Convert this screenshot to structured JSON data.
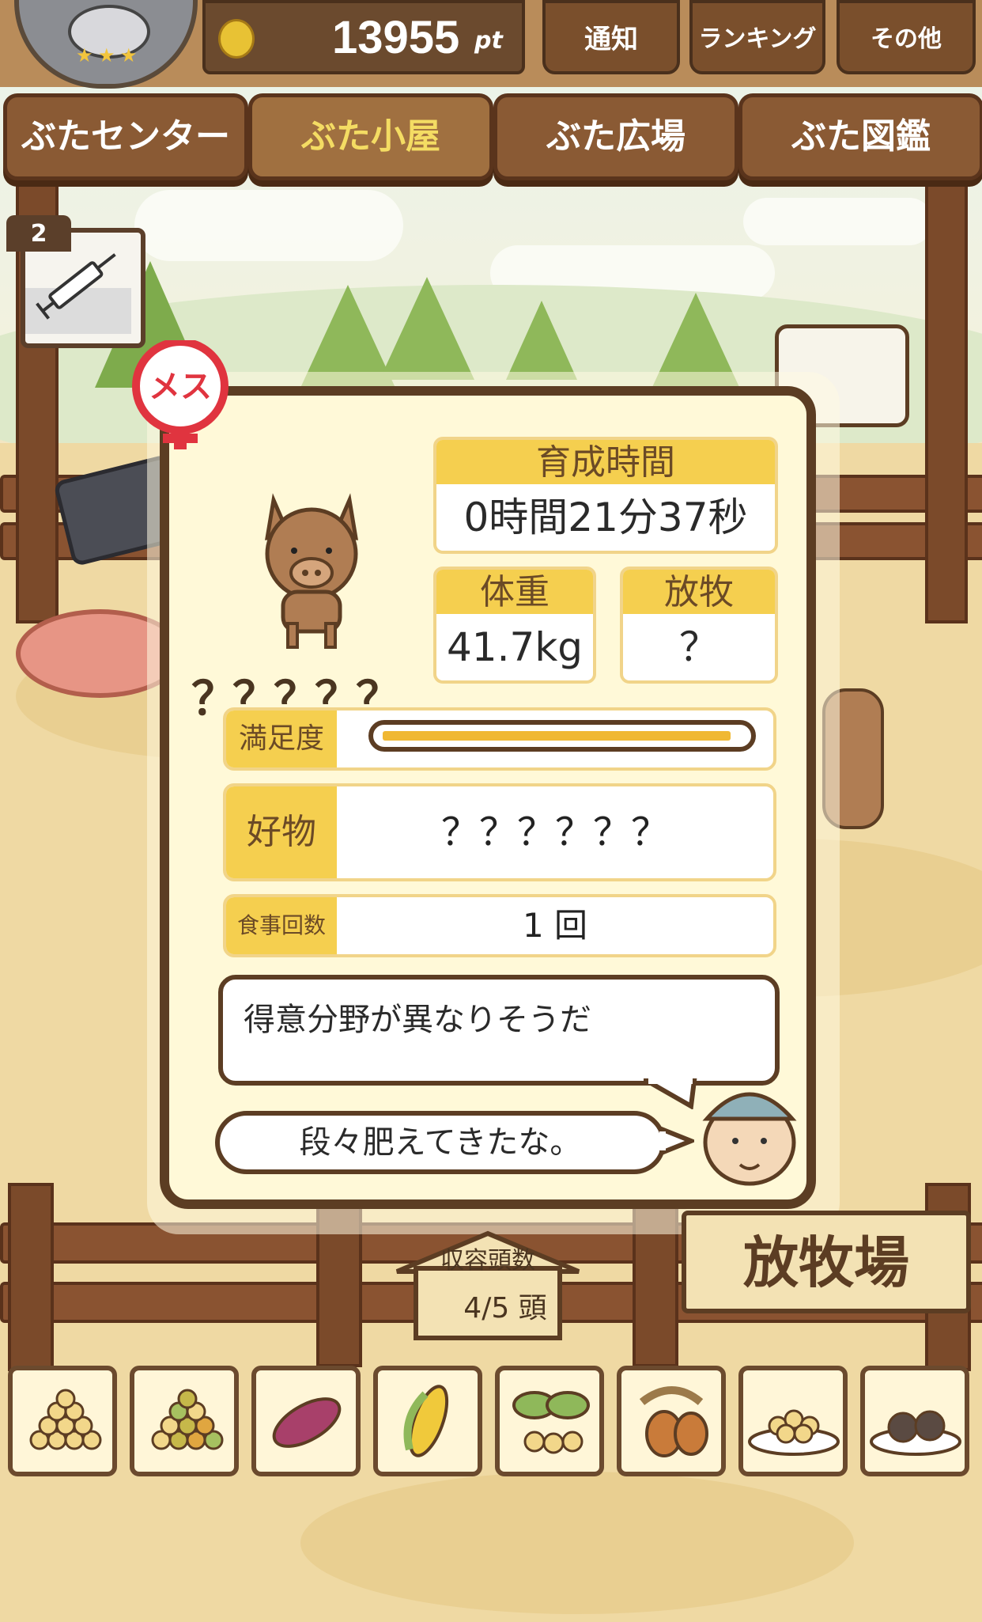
{
  "header": {
    "points_value": "13955",
    "points_unit": "pt",
    "buttons": [
      {
        "id": "notify",
        "label": "通知"
      },
      {
        "id": "ranking",
        "label": "ランキング"
      },
      {
        "id": "other",
        "label": "その他"
      }
    ]
  },
  "nav": {
    "tabs": [
      {
        "label": "ぶたセンター",
        "active": false
      },
      {
        "label": "ぶた小屋",
        "active": true
      },
      {
        "label": "ぶた広場",
        "active": false
      },
      {
        "label": "ぶた図鑑",
        "active": false
      }
    ]
  },
  "item": {
    "count": "2",
    "icon": "syringe-icon"
  },
  "pig_card": {
    "gender_label": "メス",
    "name": "？？？？？",
    "growth_time_label": "育成時間",
    "growth_time_value": "0時間21分37秒",
    "weight_label": "体重",
    "weight_value": "41.7kg",
    "pasture_label": "放牧",
    "pasture_value": "？",
    "satisfaction_label": "満足度",
    "satisfaction_fraction": 0.97,
    "favorite_label": "好物",
    "favorite_value": "？？？？？？",
    "meals_label": "食事回数",
    "meals_value": "1 回",
    "comment": "得意分野が異なりそうだ",
    "farmer_speech": "段々肥えてきたな。"
  },
  "pen": {
    "capacity_label": "収容頭数",
    "capacity_value": "4/5 頭",
    "sign_label": "放牧場"
  },
  "food_tray": [
    {
      "icon": "soybeans-icon"
    },
    {
      "icon": "mixed-beans-icon"
    },
    {
      "icon": "sweet-potato-icon"
    },
    {
      "icon": "corn-icon"
    },
    {
      "icon": "leafy-beans-icon"
    },
    {
      "icon": "acorn-icon"
    },
    {
      "icon": "bean-plate-icon"
    },
    {
      "icon": "truffle-plate-icon"
    }
  ],
  "colors": {
    "accent_yellow": "#f5cf4f",
    "wood_brown": "#5c3d23",
    "panel_cream": "#fff9d8",
    "female_red": "#e0343f"
  }
}
